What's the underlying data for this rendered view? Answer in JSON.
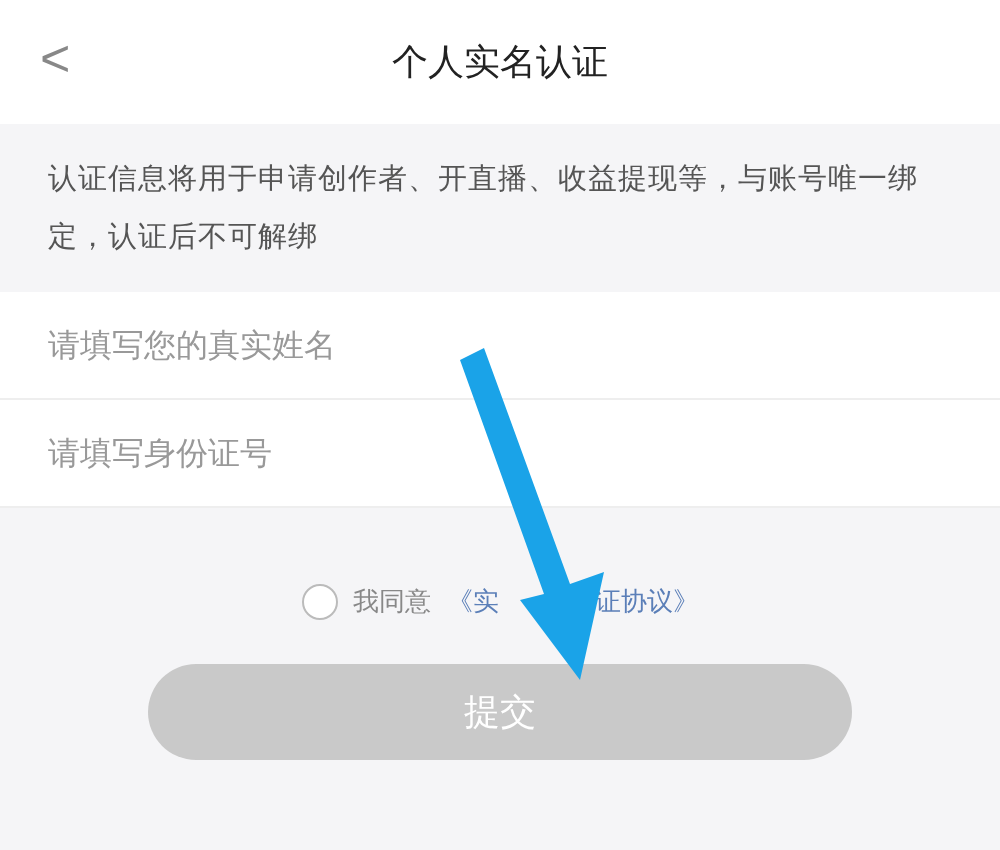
{
  "header": {
    "back_icon": "<",
    "title": "个人实名认证"
  },
  "notice": "认证信息将用于申请创作者、开直播、收益提现等，与账号唯一绑定，认证后不可解绑",
  "fields": [
    {
      "placeholder": "请填写您的真实姓名"
    },
    {
      "placeholder": "请填写身份证号"
    }
  ],
  "agreement": {
    "checked": false,
    "label": "我同意",
    "link_parts": [
      "《实",
      "证协议》"
    ]
  },
  "submit": {
    "label": "提交",
    "disabled": true
  }
}
